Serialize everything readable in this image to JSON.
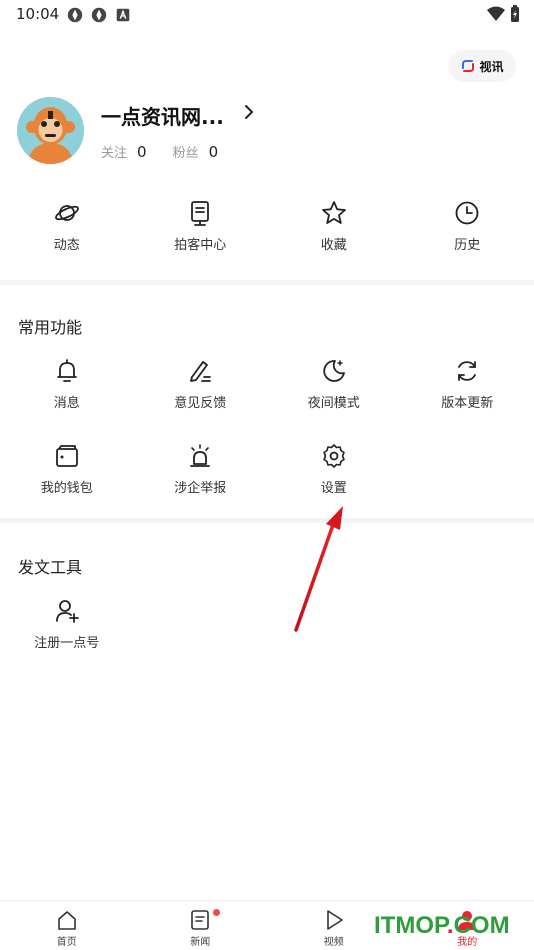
{
  "status_bar": {
    "time": "10:04"
  },
  "header": {
    "shixun_label": "视讯"
  },
  "profile": {
    "username": "一点资讯网...",
    "follow_label": "关注",
    "follow_count": "0",
    "fans_label": "粉丝",
    "fans_count": "0"
  },
  "top_grid": [
    {
      "label": "动态",
      "icon": "planet-icon"
    },
    {
      "label": "拍客中心",
      "icon": "device-icon"
    },
    {
      "label": "收藏",
      "icon": "star-icon"
    },
    {
      "label": "历史",
      "icon": "clock-icon"
    }
  ],
  "common_functions": {
    "title": "常用功能",
    "items": [
      {
        "label": "消息",
        "icon": "bell-icon"
      },
      {
        "label": "意见反馈",
        "icon": "pen-icon"
      },
      {
        "label": "夜间模式",
        "icon": "moon-icon"
      },
      {
        "label": "版本更新",
        "icon": "refresh-icon"
      },
      {
        "label": "我的钱包",
        "icon": "wallet-icon"
      },
      {
        "label": "涉企举报",
        "icon": "alarm-icon"
      },
      {
        "label": "设置",
        "icon": "gear-icon"
      }
    ]
  },
  "publish_tools": {
    "title": "发文工具",
    "items": [
      {
        "label": "注册一点号",
        "icon": "add-user-icon"
      }
    ]
  },
  "bottom_nav": [
    {
      "label": "首页",
      "icon": "home-icon"
    },
    {
      "label": "新闻",
      "icon": "news-icon"
    },
    {
      "label": "视频",
      "icon": "play-icon"
    },
    {
      "label": "我的",
      "icon": "user-icon",
      "active": true
    }
  ],
  "watermark": {
    "main": "ITMOP",
    "dot": ".",
    "suffix": "COM"
  },
  "colors": {
    "accent": "#e5262e",
    "watermark": "#2d9e3a",
    "avatar_bg": "#8ecfd8"
  }
}
